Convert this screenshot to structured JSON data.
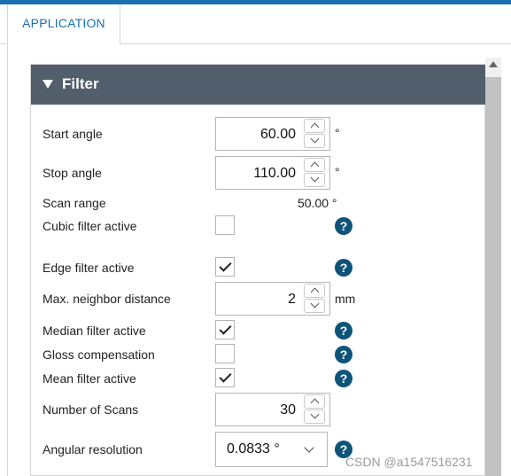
{
  "tabs": [
    {
      "label": "APPLICATION",
      "active": true
    }
  ],
  "panel": {
    "title": "Filter",
    "collapsed": false
  },
  "fields": {
    "start_angle": {
      "label": "Start angle",
      "value": "60.00",
      "unit": "°"
    },
    "stop_angle": {
      "label": "Stop angle",
      "value": "110.00",
      "unit": "°"
    },
    "scan_range": {
      "label": "Scan range",
      "value": "50.00 °"
    },
    "cubic_filter": {
      "label": "Cubic filter active",
      "checked": false
    },
    "edge_filter": {
      "label": "Edge filter active",
      "checked": true
    },
    "max_neighbor": {
      "label": "Max. neighbor distance",
      "value": "2",
      "unit": "mm"
    },
    "median_filter": {
      "label": "Median filter active",
      "checked": true
    },
    "gloss_comp": {
      "label": "Gloss compensation",
      "checked": false
    },
    "mean_filter": {
      "label": "Mean filter active",
      "checked": true
    },
    "num_scans": {
      "label": "Number of Scans",
      "value": "30"
    },
    "angular_res": {
      "label": "Angular resolution",
      "value": "0.0833 °"
    }
  },
  "help_symbol": "?",
  "watermark": "CSDN @a1547516231",
  "colors": {
    "accent": "#1a6fb0",
    "header_bg": "#525e6b",
    "help_icon": "#0e5479"
  }
}
